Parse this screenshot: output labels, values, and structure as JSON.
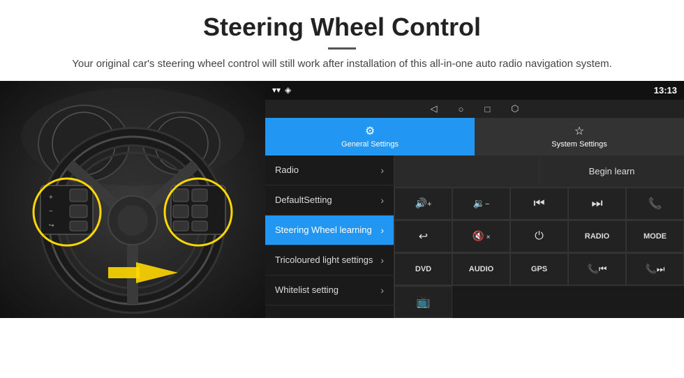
{
  "header": {
    "title": "Steering Wheel Control",
    "divider": true,
    "subtitle": "Your original car's steering wheel control will still work after installation of this all-in-one auto radio navigation system."
  },
  "status_bar": {
    "signal_icon": "▾",
    "wifi_icon": "▾",
    "time": "13:13"
  },
  "nav_bar": {
    "back": "◁",
    "home": "○",
    "recent": "□",
    "cast": "⬜"
  },
  "tabs": [
    {
      "id": "general",
      "label": "General Settings",
      "icon": "⚙",
      "active": true
    },
    {
      "id": "system",
      "label": "System Settings",
      "icon": "⚙",
      "active": false
    }
  ],
  "menu": {
    "items": [
      {
        "id": "radio",
        "label": "Radio",
        "active": false
      },
      {
        "id": "default",
        "label": "DefaultSetting",
        "active": false
      },
      {
        "id": "steering",
        "label": "Steering Wheel learning",
        "active": true
      },
      {
        "id": "tricoloured",
        "label": "Tricoloured light settings",
        "active": false
      },
      {
        "id": "whitelist",
        "label": "Whitelist setting",
        "active": false
      }
    ]
  },
  "right_panel": {
    "begin_learn": "Begin learn",
    "control_buttons": [
      {
        "id": "vol_up",
        "label": "🔊+",
        "text": "vol+"
      },
      {
        "id": "vol_down",
        "label": "🔉-",
        "text": "vol-"
      },
      {
        "id": "prev_track",
        "label": "⏮",
        "text": "prev"
      },
      {
        "id": "next_track",
        "label": "⏭",
        "text": "next"
      },
      {
        "id": "phone",
        "label": "📞",
        "text": "phone"
      },
      {
        "id": "call_end",
        "label": "↩",
        "text": "end"
      },
      {
        "id": "mute",
        "label": "🔇",
        "text": "mute"
      },
      {
        "id": "power",
        "label": "⏻",
        "text": "power"
      },
      {
        "id": "radio_btn",
        "label": "RADIO",
        "text": "RADIO"
      },
      {
        "id": "mode",
        "label": "MODE",
        "text": "MODE"
      },
      {
        "id": "dvd",
        "label": "DVD",
        "text": "DVD"
      },
      {
        "id": "audio",
        "label": "AUDIO",
        "text": "AUDIO"
      },
      {
        "id": "gps",
        "label": "GPS",
        "text": "GPS"
      },
      {
        "id": "tel_prev",
        "label": "📞⏮",
        "text": "tel-prev"
      },
      {
        "id": "tel_next",
        "label": "📞⏭",
        "text": "tel-next"
      }
    ],
    "last_row": [
      {
        "id": "media_icon",
        "label": "⬛",
        "text": "media",
        "is_icon": true
      }
    ]
  }
}
